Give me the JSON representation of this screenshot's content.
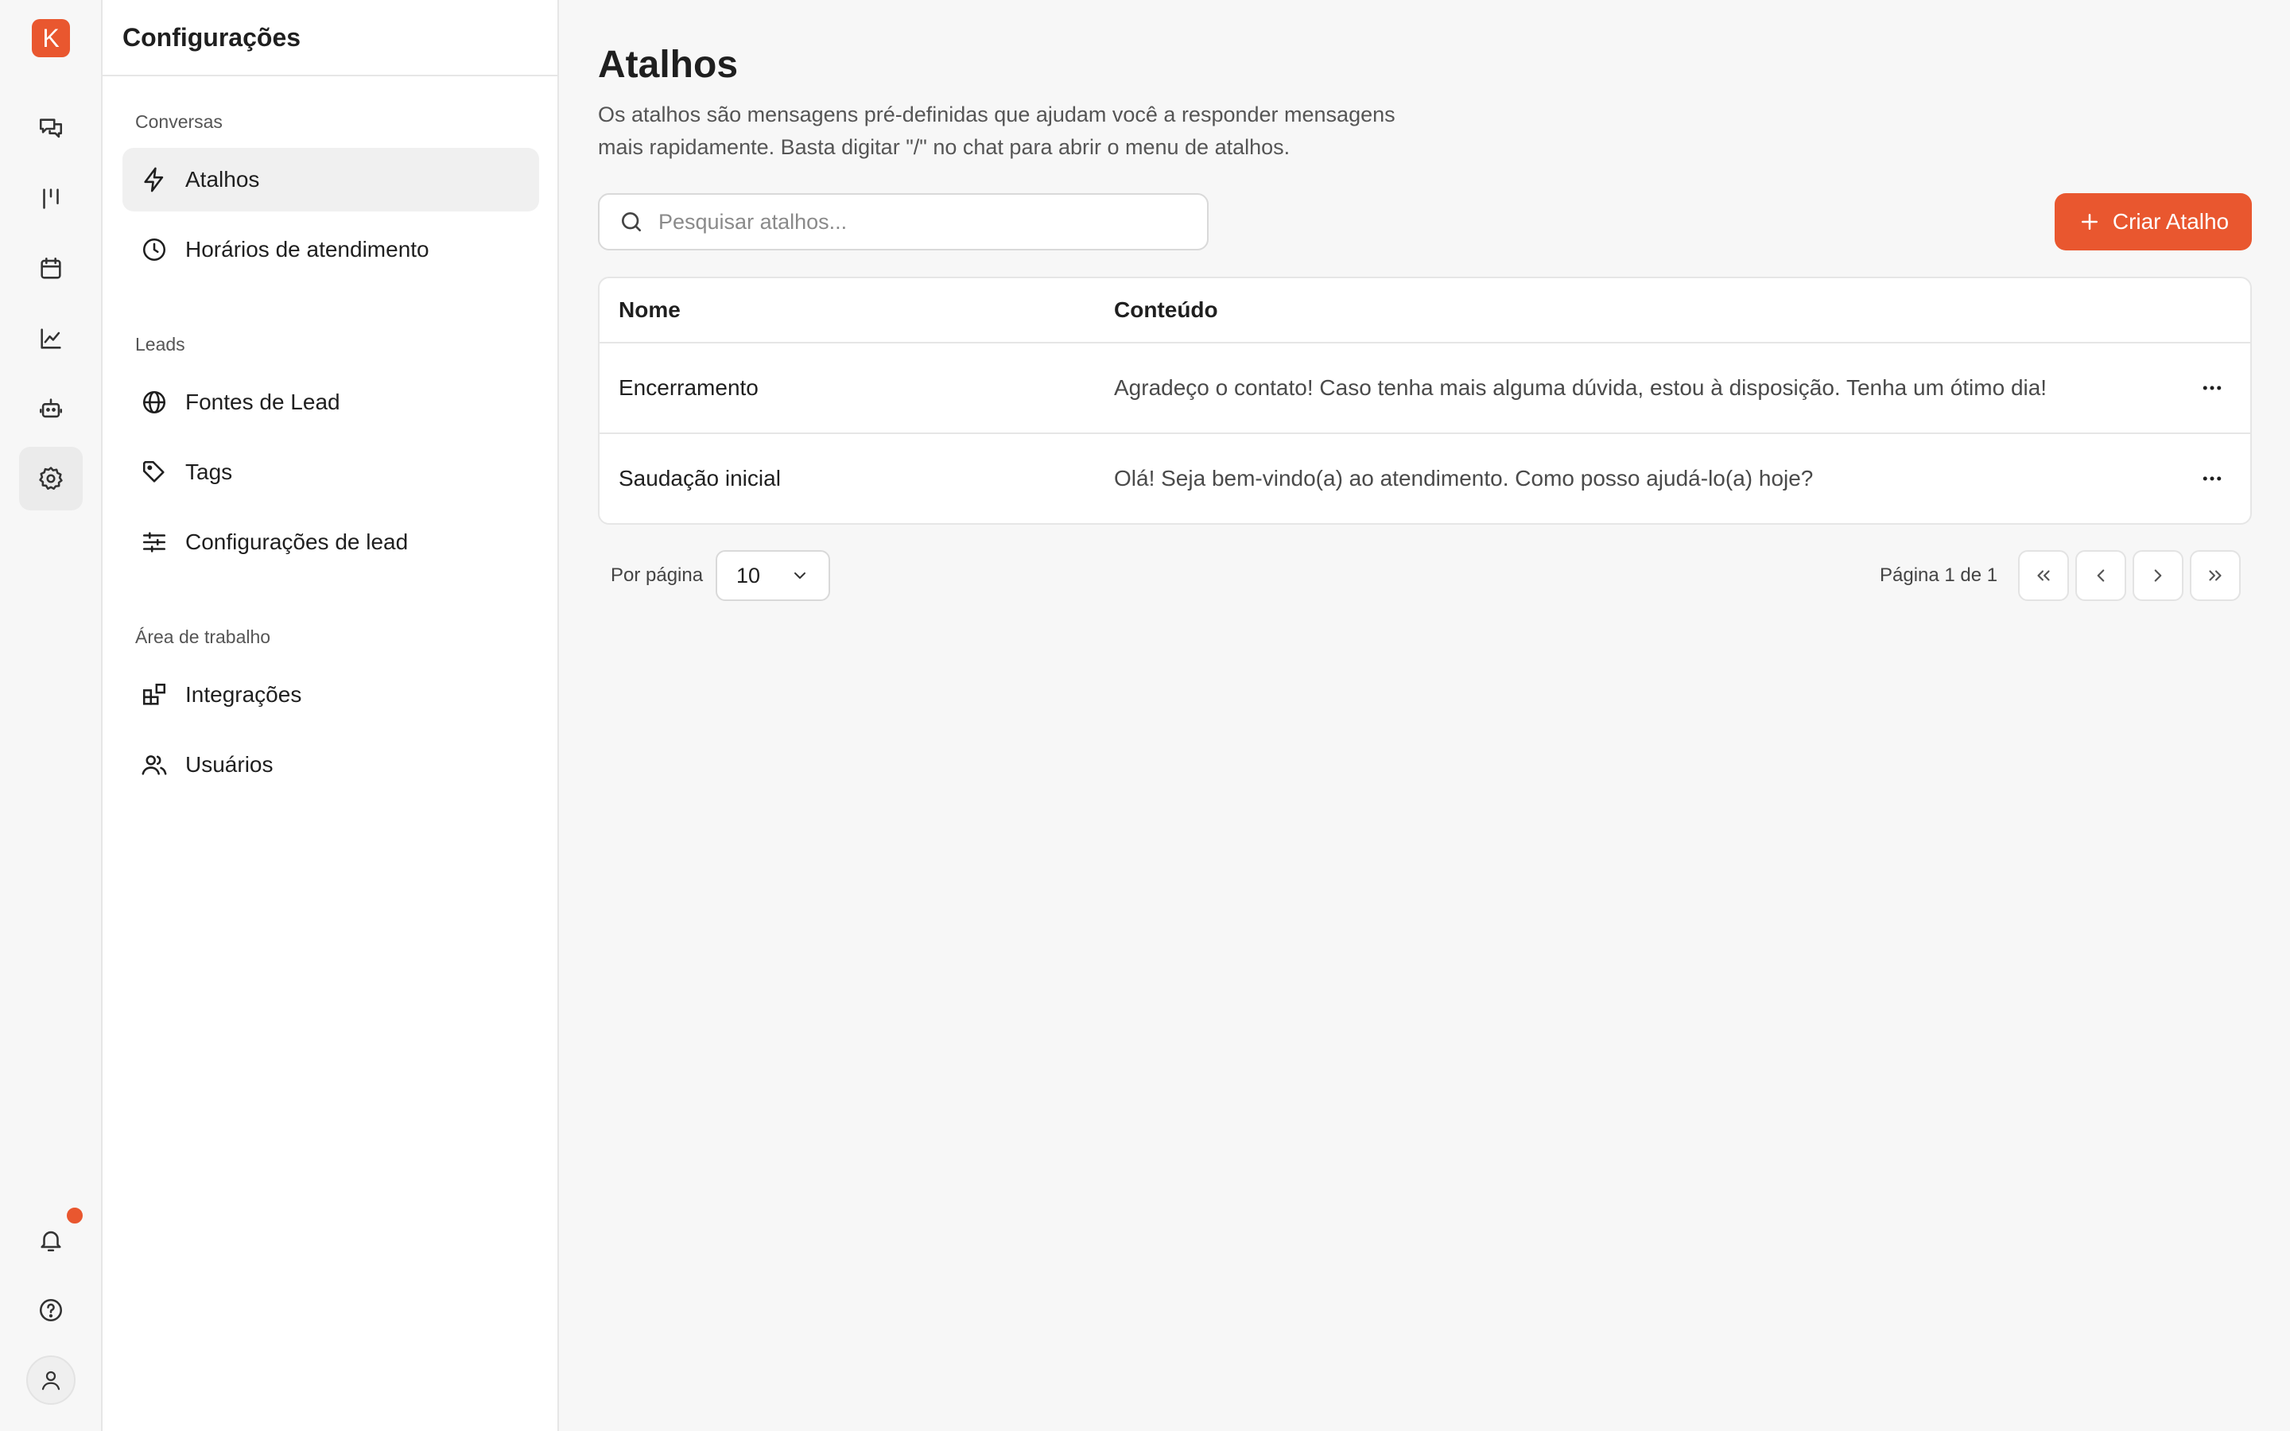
{
  "app": {
    "logo_letter": "K"
  },
  "colors": {
    "accent": "#e9572f",
    "notification": "#e9572f"
  },
  "rail": {
    "items": [
      {
        "icon": "chat-icon"
      },
      {
        "icon": "kanban-icon"
      },
      {
        "icon": "calendar-icon"
      },
      {
        "icon": "chart-icon"
      },
      {
        "icon": "bot-icon"
      },
      {
        "icon": "gear-icon",
        "active": true
      }
    ],
    "bottom": [
      {
        "icon": "bell-icon",
        "has_notification": true
      },
      {
        "icon": "help-icon"
      },
      {
        "icon": "user-icon"
      }
    ]
  },
  "sidebar": {
    "title": "Configurações",
    "sections": [
      {
        "label": "Conversas",
        "items": [
          {
            "label": "Atalhos",
            "icon": "zap-icon",
            "active": true
          },
          {
            "label": "Horários de atendimento",
            "icon": "clock-icon"
          }
        ]
      },
      {
        "label": "Leads",
        "items": [
          {
            "label": "Fontes de Lead",
            "icon": "globe-icon"
          },
          {
            "label": "Tags",
            "icon": "tag-icon"
          },
          {
            "label": "Configurações de lead",
            "icon": "sliders-icon"
          }
        ]
      },
      {
        "label": "Área de trabalho",
        "items": [
          {
            "label": "Integrações",
            "icon": "integrations-icon"
          },
          {
            "label": "Usuários",
            "icon": "users-icon"
          }
        ]
      }
    ]
  },
  "main": {
    "title": "Atalhos",
    "description": "Os atalhos são mensagens pré-definidas que ajudam você a responder mensagens mais rapidamente. Basta digitar \"/\" no chat para abrir o menu de atalhos.",
    "search_placeholder": "Pesquisar atalhos...",
    "create_button": "Criar Atalho",
    "table": {
      "columns": [
        "Nome",
        "Conteúdo"
      ],
      "rows": [
        {
          "name": "Encerramento",
          "content": "Agradeço o contato! Caso tenha mais alguma dúvida, estou à disposição. Tenha um ótimo dia!"
        },
        {
          "name": "Saudação inicial",
          "content": "Olá! Seja bem-vindo(a) ao atendimento. Como posso ajudá-lo(a) hoje?"
        }
      ]
    },
    "pagination": {
      "per_page_label": "Por página",
      "per_page_value": "10",
      "page_info": "Página 1 de 1"
    }
  }
}
